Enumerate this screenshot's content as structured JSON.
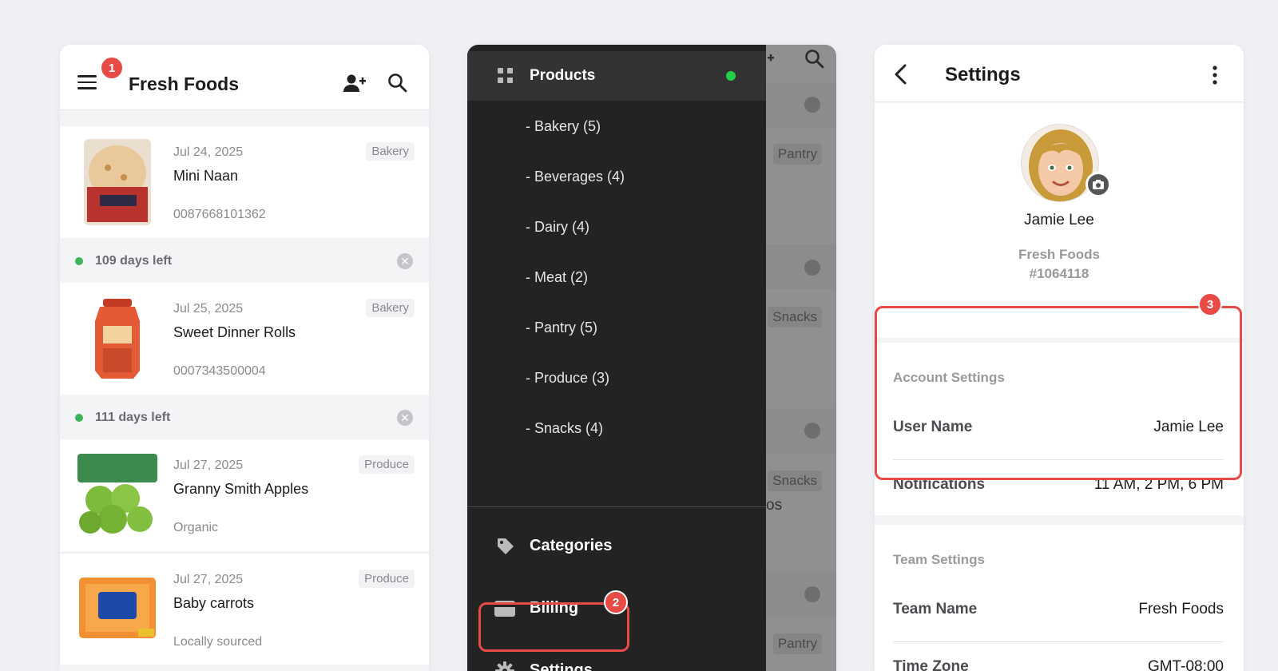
{
  "panel1": {
    "title": "Fresh Foods",
    "callout": "1",
    "items": [
      {
        "date": "Jul 24, 2025",
        "name": "Mini Naan",
        "sub": "0087668101362",
        "tag": "Bakery"
      },
      {
        "date": "Jul 25, 2025",
        "name": "Sweet Dinner Rolls",
        "sub": "0007343500004",
        "tag": "Bakery"
      },
      {
        "date": "Jul 27, 2025",
        "name": "Granny Smith Apples",
        "sub": "Organic",
        "tag": "Produce"
      },
      {
        "date": "Jul 27, 2025",
        "name": "Baby carrots",
        "sub": "Locally sourced",
        "tag": "Produce"
      }
    ],
    "days": [
      "109 days left",
      "111 days left"
    ]
  },
  "panel2": {
    "products_label": "Products",
    "subcategories": [
      "- Bakery (5)",
      "- Beverages (4)",
      "- Dairy (4)",
      "- Meat (2)",
      "- Pantry (5)",
      "- Produce (3)",
      "- Snacks (4)"
    ],
    "menu": {
      "categories": "Categories",
      "billing": "Billing",
      "settings": "Settings"
    },
    "callout": "2",
    "background_tags": [
      "Pantry",
      "Snacks",
      "Snacks",
      "Pantry"
    ],
    "background_fragment": "os"
  },
  "panel3": {
    "title": "Settings",
    "user_name": "Jamie Lee",
    "company": "Fresh Foods",
    "company_id": "#1064118",
    "callout": "3",
    "account": {
      "title": "Account Settings",
      "rows": [
        {
          "label": "User Name",
          "value": "Jamie Lee"
        },
        {
          "label": "Notifications",
          "value": "11 AM, 2 PM, 6 PM"
        }
      ]
    },
    "team": {
      "title": "Team Settings",
      "rows": [
        {
          "label": "Team Name",
          "value": "Fresh Foods"
        },
        {
          "label": "Time Zone",
          "value": "GMT-08:00"
        }
      ]
    }
  },
  "colors": {
    "accent_red": "#e84a45",
    "status_green": "#3db35a",
    "drawer_bg": "#232323",
    "online_dot": "#23d148"
  }
}
